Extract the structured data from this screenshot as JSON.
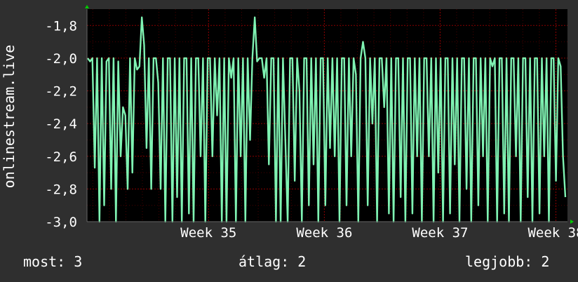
{
  "chart_data": {
    "type": "line",
    "ylabel": "onlinestream.live",
    "ylim": [
      -3.0,
      -1.7
    ],
    "y_ticks": [
      "-1,8",
      "-2,0",
      "-2,2",
      "-2,4",
      "-2,6",
      "-2,8",
      "-3,0"
    ],
    "y_tick_values": [
      -1.8,
      -2.0,
      -2.2,
      -2.4,
      -2.6,
      -2.8,
      -3.0
    ],
    "x_ticks": [
      "Week 35",
      "Week 36",
      "Week 37",
      "Week 38"
    ],
    "x_tick_values": [
      35,
      36,
      37,
      38
    ],
    "xlim": [
      33.95,
      38.1
    ],
    "grid": true,
    "colors": {
      "line": "#7ff2b2",
      "background": "#000000",
      "frame": "#2f2f2f",
      "grid": "#8b0000",
      "axis_arrow": "#00cc00"
    },
    "series": [
      {
        "values": [
          -2.0,
          -2.02,
          -2.0,
          -2.67,
          -2.0,
          -3.0,
          -2.0,
          -2.9,
          -2.02,
          -2.0,
          -2.8,
          -2.0,
          -3.0,
          -2.02,
          -2.6,
          -2.3,
          -2.35,
          -2.8,
          -2.0,
          -2.7,
          -2.0,
          -2.07,
          -2.05,
          -1.75,
          -1.92,
          -2.55,
          -2.0,
          -2.8,
          -2.0,
          -2.0,
          -2.15,
          -2.8,
          -2.0,
          -3.0,
          -2.0,
          -2.0,
          -3.0,
          -2.0,
          -2.85,
          -2.0,
          -3.0,
          -2.0,
          -2.0,
          -2.95,
          -2.0,
          -3.0,
          -2.0,
          -2.0,
          -2.6,
          -2.0,
          -3.0,
          -2.0,
          -2.0,
          -2.6,
          -2.0,
          -2.35,
          -2.0,
          -3.0,
          -2.0,
          -3.0,
          -2.0,
          -2.12,
          -2.0,
          -3.0,
          -2.0,
          -2.6,
          -2.0,
          -3.0,
          -2.0,
          -2.5,
          -2.0,
          -1.75,
          -2.02,
          -2.0,
          -2.0,
          -2.12,
          -2.0,
          -2.65,
          -2.0,
          -2.0,
          -3.0,
          -2.0,
          -3.0,
          -2.0,
          -2.5,
          -3.0,
          -2.0,
          -2.0,
          -2.75,
          -2.0,
          -2.2,
          -3.0,
          -2.0,
          -2.0,
          -2.9,
          -2.0,
          -2.65,
          -2.0,
          -3.0,
          -2.0,
          -2.0,
          -2.9,
          -2.0,
          -2.55,
          -2.0,
          -2.6,
          -2.0,
          -3.0,
          -2.0,
          -2.0,
          -2.9,
          -2.0,
          -2.6,
          -2.0,
          -2.1,
          -3.0,
          -2.0,
          -1.9,
          -2.0,
          -2.9,
          -2.0,
          -2.4,
          -2.0,
          -3.0,
          -2.0,
          -2.0,
          -2.3,
          -2.0,
          -2.95,
          -2.0,
          -3.0,
          -2.0,
          -2.0,
          -2.85,
          -2.0,
          -3.0,
          -2.0,
          -2.0,
          -2.95,
          -2.0,
          -2.6,
          -2.0,
          -3.0,
          -2.0,
          -2.0,
          -2.6,
          -2.0,
          -3.0,
          -2.0,
          -2.7,
          -2.0,
          -3.0,
          -2.0,
          -2.0,
          -2.95,
          -2.0,
          -2.65,
          -2.0,
          -3.0,
          -2.0,
          -2.0,
          -2.8,
          -2.0,
          -3.0,
          -2.0,
          -2.0,
          -2.9,
          -2.0,
          -2.6,
          -2.0,
          -3.0,
          -2.0,
          -2.05,
          -2.0,
          -3.0,
          -2.0,
          -2.0,
          -2.95,
          -2.0,
          -3.0,
          -2.0,
          -2.0,
          -2.6,
          -2.0,
          -3.0,
          -2.0,
          -2.0,
          -2.85,
          -2.0,
          -3.0,
          -2.0,
          -2.0,
          -2.95,
          -2.0,
          -2.6,
          -2.0,
          -3.0,
          -2.0,
          -2.0,
          -2.75,
          -2.0,
          -2.05,
          -2.6,
          -2.85
        ]
      }
    ]
  },
  "legend": {
    "current": "most: 3",
    "average": "átlag: 2",
    "best": "legjobb: 2"
  }
}
